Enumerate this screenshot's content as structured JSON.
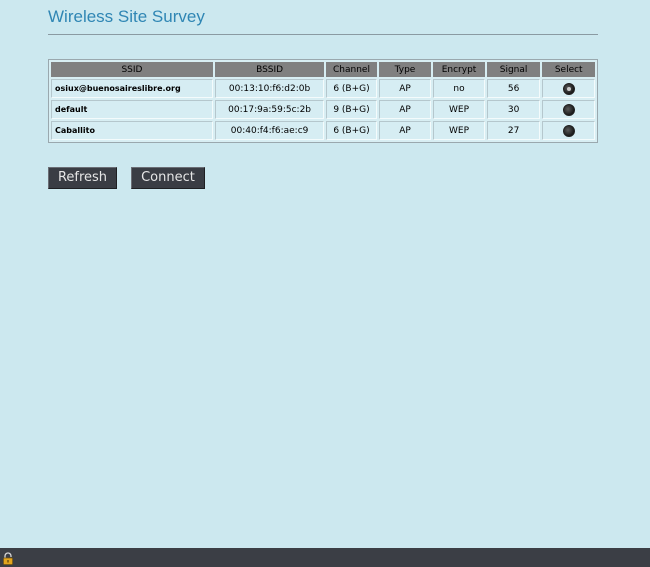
{
  "page": {
    "title": "Wireless Site Survey"
  },
  "table": {
    "headers": [
      "SSID",
      "BSSID",
      "Channel",
      "Type",
      "Encrypt",
      "Signal",
      "Select"
    ],
    "rows": [
      {
        "ssid": "osiux@buenosaireslibre.org",
        "bssid": "00:13:10:f6:d2:0b",
        "channel": "6 (B+G)",
        "type": "AP",
        "encrypt": "no",
        "signal": "56",
        "selected": true
      },
      {
        "ssid": "default",
        "bssid": "00:17:9a:59:5c:2b",
        "channel": "9 (B+G)",
        "type": "AP",
        "encrypt": "WEP",
        "signal": "30",
        "selected": false
      },
      {
        "ssid": "Caballito",
        "bssid": "00:40:f4:f6:ae:c9",
        "channel": "6 (B+G)",
        "type": "AP",
        "encrypt": "WEP",
        "signal": "27",
        "selected": false
      }
    ]
  },
  "buttons": {
    "refresh_label": "Refresh",
    "connect_label": "Connect"
  },
  "colors": {
    "background": "#cce8ef",
    "title": "#2f86b4",
    "header_bg": "#808080",
    "button_bg": "#3a3d44",
    "taskbar_bg": "#3b3e45"
  },
  "icons": {
    "taskbar": "lock-icon"
  }
}
